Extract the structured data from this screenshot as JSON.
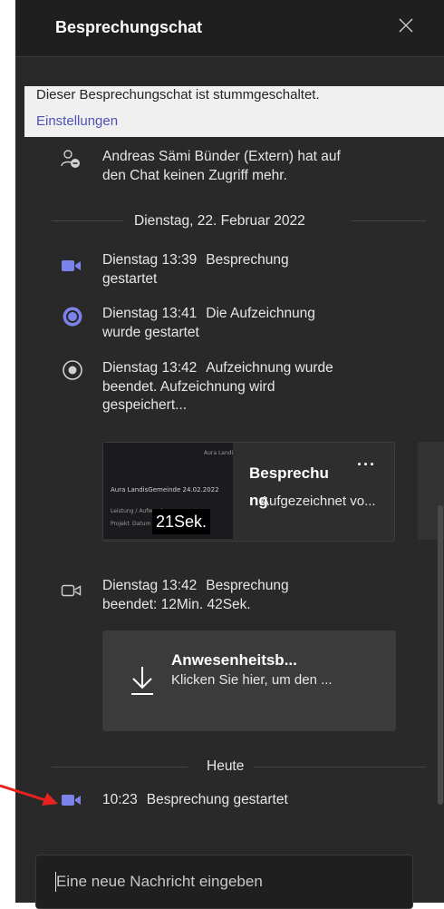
{
  "header": {
    "title": "Besprechungschat"
  },
  "banner": {
    "text": "Dieser Besprechungschat ist stummgeschaltet.",
    "link": "Einstellungen"
  },
  "events": [
    {
      "icon": "person-removed-icon",
      "time": "",
      "text": "Andreas Sämi Bünder (Extern) hat auf den Chat keinen Zugriff mehr."
    },
    {
      "icon": "video-camera-icon",
      "time": "Dienstag 13:39",
      "text": "Besprechung gestartet"
    },
    {
      "icon": "recording-icon",
      "time": "Dienstag 13:41",
      "text": "Die Aufzeichnung wurde gestartet"
    },
    {
      "icon": "stop-recording-icon",
      "time": "Dienstag 13:42",
      "text": "Aufzeichnung wurde beendet. Aufzeichnung wird gespeichert..."
    },
    {
      "icon": "video-camera-outline-icon",
      "time": "Dienstag 13:42",
      "text": "Besprechung beendet: 12Min. 42Sek."
    },
    {
      "icon": "video-camera-icon",
      "time": "10:23",
      "text": "Besprechung gestartet"
    }
  ],
  "dividers": {
    "date": "Dienstag, 22. Februar 2022",
    "today": "Heute"
  },
  "recording_card": {
    "title": "Besprechu",
    "title_overflow": "ng",
    "subtitle": "Aufgezeichnet vo...",
    "duration": "21Sek.",
    "more": "···",
    "thumbnail": {
      "header": "Aura Landi",
      "heading": "Aura LandisGemeinde 24.02.2022",
      "line1": "Leistung / Aufwand",
      "line2": "Projekt",
      "line3": "Datum"
    }
  },
  "attendance_card": {
    "title": "Anwesenheitsb...",
    "subtitle": "Klicken Sie hier, um den ..."
  },
  "composer": {
    "placeholder": "Eine neue Nachricht eingeben"
  },
  "colors": {
    "panel_bg": "#292929",
    "header_bg": "#1f1f1f",
    "accent": "#7b83eb",
    "banner_bg": "#f0f0f0",
    "link": "#4f52b2",
    "annotation_arrow": "#e8231f"
  }
}
